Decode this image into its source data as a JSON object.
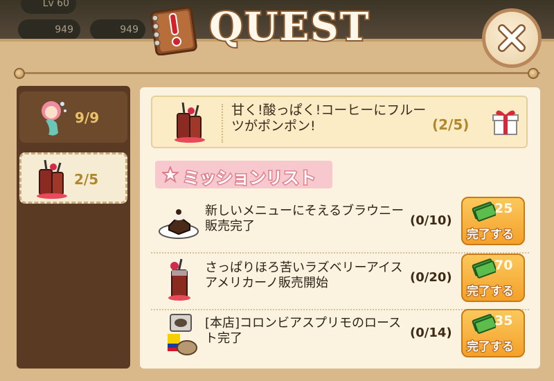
{
  "background": {
    "level_label": "Lv 60",
    "pills": [
      "949",
      "949"
    ]
  },
  "title": "QUEST",
  "close_icon": "close-icon",
  "sidebar": {
    "tabs": [
      {
        "count": "9/9",
        "icon": "mermaid-icon",
        "active": false
      },
      {
        "count": "2/5",
        "icon": "fruit-coffee-icon",
        "active": true
      }
    ]
  },
  "quest": {
    "title": "甘く!酸っぱく!コーヒーにフルーツがポンポン!",
    "progress": "(2/5)",
    "reward_icon": "gift-box-icon"
  },
  "mission_list": {
    "header": "ミッションリスト",
    "items": [
      {
        "text": "新しいメニューにそえるブラウニー販売完了",
        "progress": "(0/10)",
        "reward": "25",
        "action": "完了する",
        "icon": "brownie-plate-icon"
      },
      {
        "text": "さっぱりほろ苦いラズベリーアイスアメリカーノ販売開始",
        "progress": "(0/20)",
        "reward": "70",
        "action": "完了する",
        "icon": "raspberry-iced-americano-icon"
      },
      {
        "text": "[本店]コロンビアスプリモのロースト完了",
        "progress": "(0/14)",
        "reward": "35",
        "action": "完了する",
        "icon": "coffee-bean-sack-icon"
      }
    ]
  },
  "colors": {
    "panel": "#d9b98a",
    "accent": "#f4a12a",
    "pink": "#f7c9cf"
  }
}
